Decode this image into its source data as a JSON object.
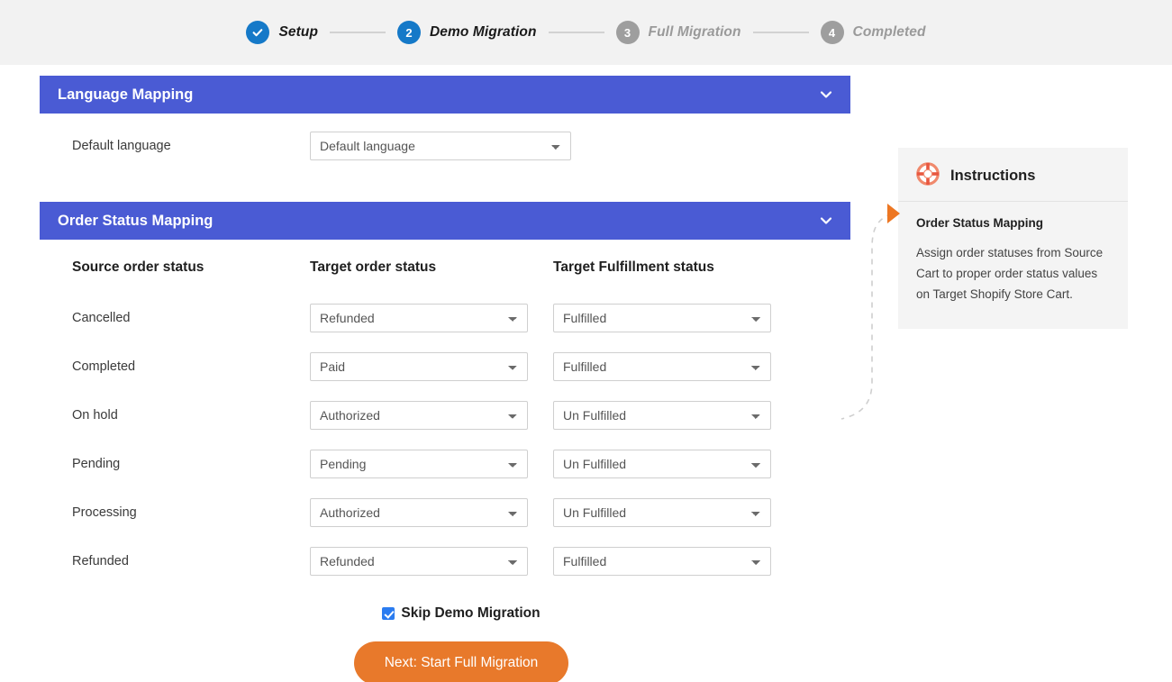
{
  "stepper": {
    "steps": [
      {
        "id": "setup",
        "marker": "check",
        "label": "Setup",
        "state": "done"
      },
      {
        "id": "demo-migration",
        "marker": "2",
        "label": "Demo Migration",
        "state": "active"
      },
      {
        "id": "full-migration",
        "marker": "3",
        "label": "Full Migration",
        "state": "todo"
      },
      {
        "id": "completed",
        "marker": "4",
        "label": "Completed",
        "state": "todo"
      }
    ]
  },
  "language_mapping": {
    "header": "Language Mapping",
    "collapse_icon": "chevron-down-icon",
    "label": "Default language",
    "select_value": "Default language"
  },
  "order_status_mapping": {
    "header": "Order Status Mapping",
    "collapse_icon": "chevron-down-icon",
    "columns": [
      "Source order status",
      "Target order status",
      "Target Fulfillment status"
    ],
    "rows": [
      {
        "source": "Cancelled",
        "target_order": "Refunded",
        "target_fulfillment": "Fulfilled"
      },
      {
        "source": "Completed",
        "target_order": "Paid",
        "target_fulfillment": "Fulfilled"
      },
      {
        "source": "On hold",
        "target_order": "Authorized",
        "target_fulfillment": "Un Fulfilled"
      },
      {
        "source": "Pending",
        "target_order": "Pending",
        "target_fulfillment": "Un Fulfilled"
      },
      {
        "source": "Processing",
        "target_order": "Authorized",
        "target_fulfillment": "Un Fulfilled"
      },
      {
        "source": "Refunded",
        "target_order": "Refunded",
        "target_fulfillment": "Fulfilled"
      }
    ]
  },
  "skip_demo": {
    "label": "Skip Demo Migration",
    "checked": true
  },
  "primary_action": {
    "label": "Next: Start Full Migration"
  },
  "instructions": {
    "icon": "lifebuoy-icon",
    "title": "Instructions",
    "section_title": "Order Status Mapping",
    "body": "Assign order statuses from Source Cart to proper order status values on Target Shopify Store Cart."
  },
  "colors": {
    "panel_header_blue": "#4a5bd4",
    "step_active_blue": "#1579c8",
    "step_inactive_gray": "#9e9e9e",
    "primary_orange": "#e8792b",
    "marker_orange": "#ed7723",
    "checkbox_blue": "#2b7cf0",
    "topbar_gray": "#f2f2f2",
    "instructions_bg": "#f4f4f4"
  }
}
